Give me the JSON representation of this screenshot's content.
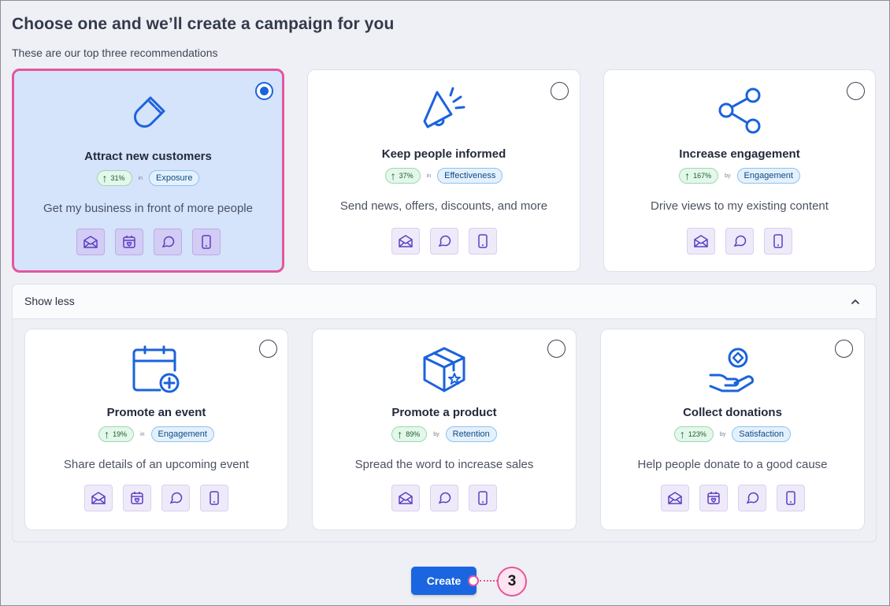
{
  "header": {
    "title": "Choose one and we’ll create a campaign for you",
    "subtitle": "These are our top three recommendations"
  },
  "top_cards": [
    {
      "title": "Attract new customers",
      "icon": "magnet-icon",
      "percent": "31%",
      "joiner": "in",
      "category": "Exposure",
      "description": "Get my business in front of more people",
      "selected": true,
      "channels": [
        "email-icon",
        "calendar-icon",
        "social-icon",
        "sms-icon"
      ]
    },
    {
      "title": "Keep people informed",
      "icon": "megaphone-icon",
      "percent": "37%",
      "joiner": "in",
      "category": "Effectiveness",
      "description": "Send news, offers, discounts, and more",
      "selected": false,
      "channels": [
        "email-icon",
        "social-icon",
        "sms-icon"
      ]
    },
    {
      "title": "Increase engagement",
      "icon": "share-icon",
      "percent": "167%",
      "joiner": "by",
      "category": "Engagement",
      "description": "Drive views to my existing content",
      "selected": false,
      "channels": [
        "email-icon",
        "social-icon",
        "sms-icon"
      ]
    }
  ],
  "more_section": {
    "toggle_label": "Show less",
    "toggle_icon": "chevron-up-icon"
  },
  "bottom_cards": [
    {
      "title": "Promote an event",
      "icon": "calendar-add-icon",
      "percent": "19%",
      "joiner": "in",
      "category": "Engagement",
      "description": "Share details of an upcoming event",
      "selected": false,
      "channels": [
        "email-icon",
        "calendar-icon",
        "social-icon",
        "sms-icon"
      ]
    },
    {
      "title": "Promote a product",
      "icon": "product-box-icon",
      "percent": "89%",
      "joiner": "by",
      "category": "Retention",
      "description": "Spread the word to increase sales",
      "selected": false,
      "channels": [
        "email-icon",
        "social-icon",
        "sms-icon"
      ]
    },
    {
      "title": "Collect donations",
      "icon": "donation-hand-icon",
      "percent": "123%",
      "joiner": "by",
      "category": "Satisfaction",
      "description": "Help people donate to a good cause",
      "selected": false,
      "channels": [
        "email-icon",
        "calendar-icon",
        "social-icon",
        "sms-icon"
      ]
    }
  ],
  "footer": {
    "create_label": "Create",
    "callout_number": "3"
  },
  "colors": {
    "primary": "#1b66e0",
    "highlight": "#e4569c",
    "selected_bg": "#d5e3fb"
  }
}
